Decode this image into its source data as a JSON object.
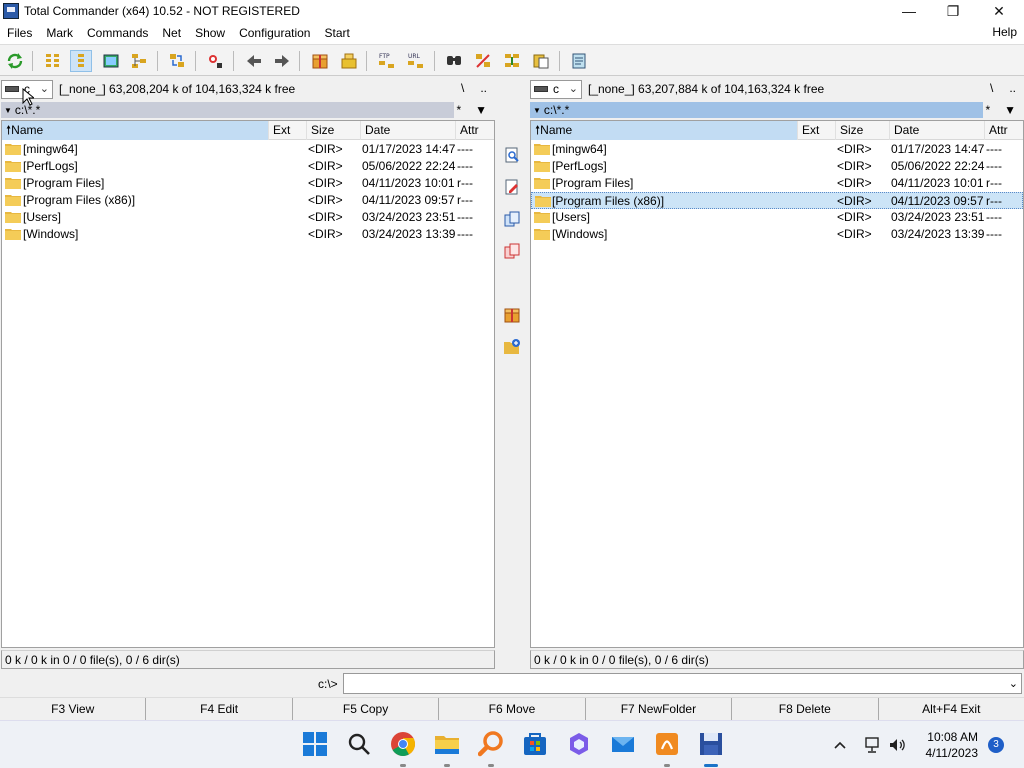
{
  "window": {
    "title": "Total Commander (x64) 10.52 - NOT REGISTERED",
    "minimize": "—",
    "maximize": "❐",
    "close": "✕"
  },
  "menu": {
    "items": [
      "Files",
      "Mark",
      "Commands",
      "Net",
      "Show",
      "Configuration",
      "Start"
    ],
    "help": "Help"
  },
  "toolbar": {
    "buttons": [
      "refresh-icon",
      "brief-view-icon",
      "detailed-view-icon",
      "thumbnails-icon",
      "tree-view-icon",
      "sync-dirs-icon",
      "multi-rename-icon",
      "back-icon",
      "forward-icon",
      "pack-icon",
      "unpack-icon",
      "ftp-icon",
      "url-icon",
      "find-icon",
      "sync-icon",
      "compare-icon",
      "copy-names-icon",
      "notepad-icon"
    ],
    "ftp_label": "FTP",
    "url_label": "URL"
  },
  "columns": {
    "name": "Name",
    "ext": "Ext",
    "size": "Size",
    "date": "Date",
    "attr": "Attr"
  },
  "left": {
    "drive": "c",
    "disk_info": "[_none_]  63,208,204 k of 104,163,324 k free",
    "root_btn": "\\",
    "up_btn": "..",
    "path": "c:\\*.*",
    "hist_star": "*",
    "hist_arrow": "▼",
    "files": [
      {
        "name": "[mingw64]",
        "size": "<DIR>",
        "date": "01/17/2023 14:47",
        "attr": "----"
      },
      {
        "name": "[PerfLogs]",
        "size": "<DIR>",
        "date": "05/06/2022 22:24",
        "attr": "----"
      },
      {
        "name": "[Program Files]",
        "size": "<DIR>",
        "date": "04/11/2023 10:01",
        "attr": "r---"
      },
      {
        "name": "[Program Files (x86)]",
        "size": "<DIR>",
        "date": "04/11/2023 09:57",
        "attr": "r---"
      },
      {
        "name": "[Users]",
        "size": "<DIR>",
        "date": "03/24/2023 23:51",
        "attr": "----"
      },
      {
        "name": "[Windows]",
        "size": "<DIR>",
        "date": "03/24/2023 13:39",
        "attr": "----"
      }
    ],
    "status": "0 k / 0 k in 0 / 0 file(s), 0 / 6 dir(s)"
  },
  "right": {
    "drive": "c",
    "disk_info": "[_none_]  63,207,884 k of 104,163,324 k free",
    "root_btn": "\\",
    "up_btn": "..",
    "path": "c:\\*.*",
    "hist_star": "*",
    "hist_arrow": "▼",
    "files": [
      {
        "name": "[mingw64]",
        "size": "<DIR>",
        "date": "01/17/2023 14:47",
        "attr": "----"
      },
      {
        "name": "[PerfLogs]",
        "size": "<DIR>",
        "date": "05/06/2022 22:24",
        "attr": "----"
      },
      {
        "name": "[Program Files]",
        "size": "<DIR>",
        "date": "04/11/2023 10:01",
        "attr": "r---"
      },
      {
        "name": "[Program Files (x86)]",
        "size": "<DIR>",
        "date": "04/11/2023 09:57",
        "attr": "r---"
      },
      {
        "name": "[Users]",
        "size": "<DIR>",
        "date": "03/24/2023 23:51",
        "attr": "----"
      },
      {
        "name": "[Windows]",
        "size": "<DIR>",
        "date": "03/24/2023 13:39",
        "attr": "----"
      }
    ],
    "status": "0 k / 0 k in 0 / 0 file(s), 0 / 6 dir(s)"
  },
  "command": {
    "prompt": "c:\\>",
    "value": ""
  },
  "fkeys": [
    "F3 View",
    "F4 Edit",
    "F5 Copy",
    "F6 Move",
    "F7 NewFolder",
    "F8 Delete",
    "Alt+F4 Exit"
  ],
  "taskbar": {
    "time": "10:08 AM",
    "date": "4/11/2023",
    "notifications": "3"
  },
  "colors": {
    "active_path": "#9fc1e6",
    "inactive_path": "#c8ccd8",
    "selected_row": "#cce4f7",
    "folder": "#e8b840"
  }
}
